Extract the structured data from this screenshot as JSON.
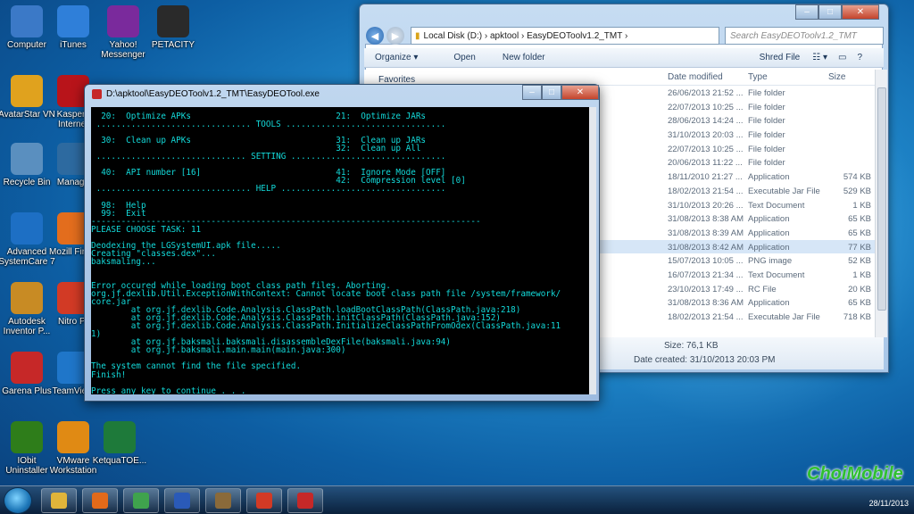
{
  "desktop_icons": [
    {
      "label": "Computer",
      "icon": "computer-icon",
      "color": "#3b79c7"
    },
    {
      "label": "iTunes",
      "icon": "itunes-icon",
      "color": "#2f7fd9"
    },
    {
      "label": "Yahoo! Messenger",
      "icon": "yahoo-messenger-icon",
      "color": "#7a2a9c"
    },
    {
      "label": "PETACITY",
      "icon": "petacity-icon",
      "color": "#2a2a2a"
    },
    {
      "label": "AvatarStar VN",
      "icon": "avatarstar-icon",
      "color": "#e0a21e"
    },
    {
      "label": "Kaspers Internet",
      "icon": "kaspersky-icon",
      "color": "#b8141a"
    },
    {
      "label": "Recycle Bin",
      "icon": "recycle-bin-icon",
      "color": "#5a8fbf"
    },
    {
      "label": "Manage",
      "icon": "manager-icon",
      "color": "#2d6aa0"
    },
    {
      "label": "Advanced SystemCare 7",
      "icon": "advanced-systemcare-icon",
      "color": "#1d6fc4"
    },
    {
      "label": "Mozill Firefo",
      "icon": "firefox-icon",
      "color": "#e36d1d"
    },
    {
      "label": "Autodesk Inventor P...",
      "icon": "autodesk-inventor-icon",
      "color": "#c88b24"
    },
    {
      "label": "Nitro Pr",
      "icon": "nitro-pro-icon",
      "color": "#d23a25"
    },
    {
      "label": "Garena Plus",
      "icon": "garena-plus-icon",
      "color": "#c62828"
    },
    {
      "label": "TeamVie 8",
      "icon": "teamviewer-icon",
      "color": "#1f76c9"
    },
    {
      "label": "IObit Uninstaller",
      "icon": "iobit-uninstaller-icon",
      "color": "#2e7d1a"
    },
    {
      "label": "VMware Workstation",
      "icon": "vmware-icon",
      "color": "#e08a14"
    },
    {
      "label": "KetquaTOE...",
      "icon": "excel-file-icon",
      "color": "#1e7a3a"
    }
  ],
  "explorer": {
    "address": "Local Disk (D:)  ›  apktool  ›  EasyDEOToolv1.2_TMT  ›",
    "search_placeholder": "Search EasyDEOToolv1.2_TMT",
    "toolbar": {
      "organize": "Organize ▾",
      "open": "Open",
      "new_folder": "New folder",
      "shred": "Shred File"
    },
    "nav_item": "Favorites",
    "columns": {
      "date": "Date modified",
      "type": "Type",
      "size": "Size"
    },
    "rows": [
      {
        "date": "26/06/2013 21:52 ...",
        "type": "File folder",
        "size": "",
        "selected": false
      },
      {
        "date": "22/07/2013 10:25 ...",
        "type": "File folder",
        "size": "",
        "selected": false
      },
      {
        "date": "28/06/2013 14:24 ...",
        "type": "File folder",
        "size": "",
        "selected": false
      },
      {
        "date": "31/10/2013 20:03 ...",
        "type": "File folder",
        "size": "",
        "selected": false
      },
      {
        "date": "22/07/2013 10:25 ...",
        "type": "File folder",
        "size": "",
        "selected": false
      },
      {
        "date": "20/06/2013 11:22 ...",
        "type": "File folder",
        "size": "",
        "selected": false
      },
      {
        "date": "18/11/2010 21:27 ...",
        "type": "Application",
        "size": "574 KB",
        "selected": false
      },
      {
        "date": "18/02/2013 21:54 ...",
        "type": "Executable Jar File",
        "size": "529 KB",
        "selected": false
      },
      {
        "date": "31/10/2013 20:26 ...",
        "type": "Text Document",
        "size": "1 KB",
        "selected": false
      },
      {
        "date": "31/08/2013 8:38 AM",
        "type": "Application",
        "size": "65 KB",
        "selected": false
      },
      {
        "date": "31/08/2013 8:39 AM",
        "type": "Application",
        "size": "65 KB",
        "selected": false
      },
      {
        "date": "31/08/2013 8:42 AM",
        "type": "Application",
        "size": "77 KB",
        "selected": true
      },
      {
        "date": "15/07/2013 10:05 ...",
        "type": "PNG image",
        "size": "52 KB",
        "selected": false
      },
      {
        "date": "16/07/2013 21:34 ...",
        "type": "Text Document",
        "size": "1 KB",
        "selected": false
      },
      {
        "date": "23/10/2013 17:49 ...",
        "type": "RC File",
        "size": "20 KB",
        "selected": false
      },
      {
        "date": "31/08/2013 8:36 AM",
        "type": "Application",
        "size": "65 KB",
        "selected": false
      },
      {
        "date": "18/02/2013 21:54 ...",
        "type": "Executable Jar File",
        "size": "718 KB",
        "selected": false
      }
    ],
    "details": {
      "size": "Size: 76,1 KB",
      "date_created": "Date created: 31/10/2013 20:03 PM"
    }
  },
  "console": {
    "title": "D:\\apktool\\EasyDEOToolv1.2_TMT\\EasyDEOTool.exe",
    "lines": [
      "  20:  Optimize APKs                             21:  Optimize JARs",
      " ............................... TOOLS ................................",
      "",
      "  30:  Clean up APKs                             31:  Clean up JARs",
      "                                                 32:  Clean up All",
      " .............................. SETTING ...............................",
      "",
      "  40:  API number [16]                           41:  Ignore Mode [OFF]",
      "                                                 42:  Compression level [0]",
      " ............................... HELP .................................",
      "",
      "  98:  Help",
      "  99:  Exit",
      "------------------------------------------------------------------------------",
      "PLEASE CHOOSE TASK: 11",
      "",
      "Deodexing the LGSystemUI.apk file.....",
      "Creating \"classes.dex\"...",
      "baksmaling...",
      "",
      "",
      "Error occured while loading boot class path files. Aborting.",
      "org.jf.dexlib.Util.ExceptionWithContext: Cannot locate boot class path file /system/framework/",
      "core.jar",
      "        at org.jf.dexlib.Code.Analysis.ClassPath.loadBootClassPath(ClassPath.java:218)",
      "        at org.jf.dexlib.Code.Analysis.ClassPath.initClassPath(ClassPath.java:152)",
      "        at org.jf.dexlib.Code.Analysis.ClassPath.InitializeClassPathFromOdex(ClassPath.java:11",
      "1)",
      "        at org.jf.baksmali.baksmali.disassembleDexFile(baksmali.java:94)",
      "        at org.jf.baksmali.main.main(main.java:300)",
      "",
      "The system cannot find the file specified.",
      "Finish!",
      "",
      "Press any key to continue . . . _"
    ]
  },
  "taskbar": {
    "buttons": [
      "explorer-icon",
      "media-player-icon",
      "chrome-icon",
      "word-icon",
      "winrar-icon",
      "nitro-icon",
      "android-apk-icon"
    ],
    "clock_date": "28/11/2013"
  },
  "watermark": "ChoiMobile"
}
